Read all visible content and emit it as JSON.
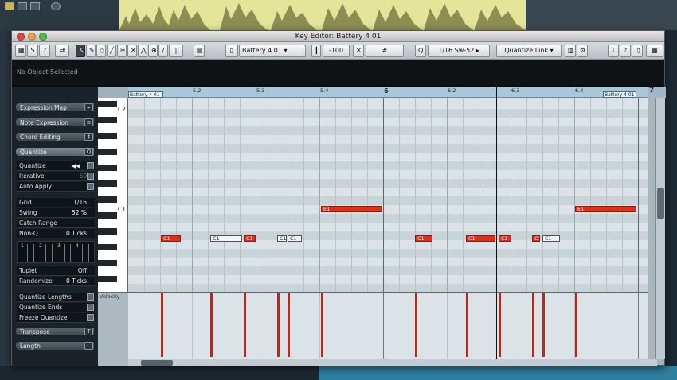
{
  "window": {
    "title": "Key Editor: Battery 4 01"
  },
  "toolbar": {
    "track_name": "Battery 4 01",
    "nudge_value": "-100",
    "quantize_value": "1/16 Sw-52",
    "quantize_link": "Quantize Link",
    "q_label": "Q"
  },
  "infoline": {
    "text": "No Object Selected"
  },
  "inspector": {
    "sections": [
      {
        "label": "Expression Map"
      },
      {
        "label": "Note Expression"
      },
      {
        "label": "Chord Editing"
      },
      {
        "label": "Quantize"
      }
    ],
    "quantize_rows": [
      {
        "label": "Quantize",
        "value": ""
      },
      {
        "label": "Iterative",
        "value": "60"
      },
      {
        "label": "Auto Apply",
        "value": ""
      }
    ],
    "param_rows": [
      {
        "label": "Grid",
        "value": "1/16"
      },
      {
        "label": "Swing",
        "value": "52 %"
      },
      {
        "label": "Catch Range",
        "value": ""
      },
      {
        "label": "Non-Q",
        "value": "0 Ticks"
      }
    ],
    "grid_numbers": [
      "1",
      "2",
      "3",
      "4"
    ],
    "tuplet": {
      "label": "Tuplet",
      "value": "Off"
    },
    "randomize": {
      "label": "Randomize",
      "value": "0 Ticks"
    },
    "actions": [
      {
        "label": "Quantize Lengths"
      },
      {
        "label": "Quantize Ends"
      },
      {
        "label": "Freeze Quantize"
      }
    ],
    "bottom_sections": [
      {
        "label": "Transpose",
        "icon": "T"
      },
      {
        "label": "Length",
        "icon": "L"
      }
    ]
  },
  "ruler": {
    "labels": [
      "5.2",
      "5.3",
      "5.4",
      "6",
      "6.2",
      "6.3",
      "6.4",
      "7"
    ],
    "event_left": "Battery 4 01",
    "event_right": "Battery 4 01"
  },
  "keyboard": {
    "labels": [
      "C2",
      "C1"
    ]
  },
  "notes": [
    {
      "label": "E1",
      "selected": false
    },
    {
      "label": "E1",
      "selected": false
    },
    {
      "label": "C1",
      "selected": false
    },
    {
      "label": "C1",
      "selected": true
    },
    {
      "label": "C1",
      "selected": false
    },
    {
      "label": "C1",
      "selected": true
    },
    {
      "label": "C1",
      "selected": true
    },
    {
      "label": "C1",
      "selected": false
    },
    {
      "label": "C1",
      "selected": false
    },
    {
      "label": "C1",
      "selected": false
    },
    {
      "label": "C1",
      "selected": false
    },
    {
      "label": "C1",
      "selected": true
    }
  ],
  "velocity": {
    "label": "Velocity"
  },
  "colors": {
    "note": "#de2e1c",
    "velocity_bar": "#b22b1d",
    "ruler": "#a9c7d8"
  }
}
